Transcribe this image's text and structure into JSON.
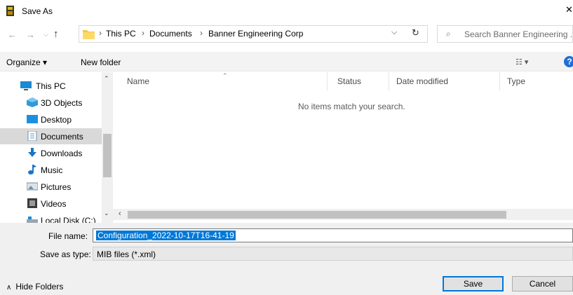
{
  "window": {
    "title": "Save As",
    "close_glyph": "✕"
  },
  "nav_buttons": {
    "back": "←",
    "forward": "→",
    "recent": "⌵",
    "up": "↑"
  },
  "address": {
    "breadcrumbs": [
      "This PC",
      "Documents",
      "Banner Engineering Corp"
    ],
    "separator": "›",
    "dropdown_glyph": "⌵",
    "refresh_glyph": "↻"
  },
  "search": {
    "placeholder": "Search Banner Engineering ...",
    "icon_glyph": "⌕"
  },
  "toolbar": {
    "organize_label": "Organize ▾",
    "new_folder_label": "New folder",
    "view_label": "☷ ▾",
    "help_label": "?"
  },
  "nav_pane": {
    "items": [
      {
        "label": "This PC",
        "icon": "pc-icon"
      },
      {
        "label": "3D Objects",
        "icon": "cube-icon"
      },
      {
        "label": "Desktop",
        "icon": "desktop-icon"
      },
      {
        "label": "Documents",
        "icon": "documents-icon",
        "selected": true
      },
      {
        "label": "Downloads",
        "icon": "download-arrow-icon"
      },
      {
        "label": "Music",
        "icon": "music-note-icon"
      },
      {
        "label": "Pictures",
        "icon": "pictures-icon"
      },
      {
        "label": "Videos",
        "icon": "film-icon"
      },
      {
        "label": "Local Disk (C:)",
        "icon": "disk-icon"
      }
    ],
    "scroll_up_glyph": "⌃",
    "scroll_down_glyph": "⌄"
  },
  "file_list": {
    "columns": [
      "Name",
      "Status",
      "Date modified",
      "Type"
    ],
    "sort_glyph": "⌃",
    "empty_message": "No items match your search.",
    "hscroll_left_glyph": "‹"
  },
  "form": {
    "file_name_label": "File name:",
    "file_name_value": "Configuration_2022-10-17T16-41-19",
    "save_type_label": "Save as type:",
    "save_type_value": "MIB files (*.xml)"
  },
  "footer": {
    "hide_folders_label": "Hide Folders",
    "hide_folders_glyph": "∧",
    "save_label": "Save",
    "cancel_label": "Cancel"
  },
  "colors": {
    "accent": "#0078d7",
    "selection": "#d9d9d9",
    "help": "#1e6ed6"
  }
}
